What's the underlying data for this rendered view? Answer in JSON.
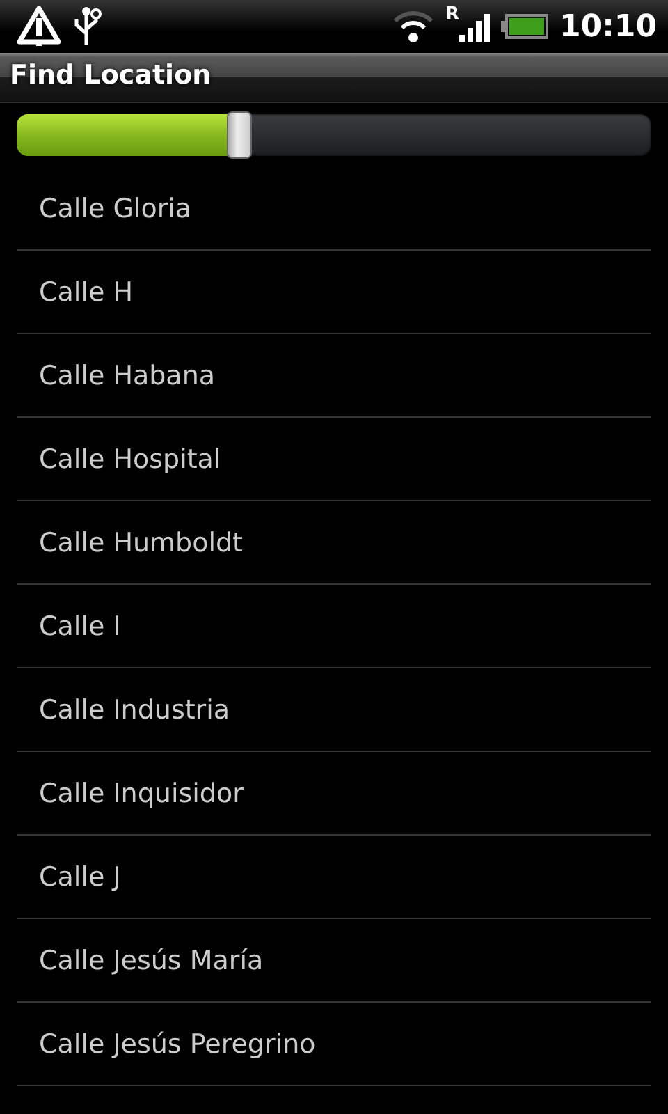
{
  "status_bar": {
    "time": "10:10",
    "network_letter": "R"
  },
  "title_bar": {
    "title": "Find Location"
  },
  "slider": {
    "level": 0.35
  },
  "list": {
    "items": [
      {
        "label": "Calle Gloria"
      },
      {
        "label": "Calle H"
      },
      {
        "label": "Calle Habana"
      },
      {
        "label": "Calle Hospital"
      },
      {
        "label": "Calle Humboldt"
      },
      {
        "label": "Calle I"
      },
      {
        "label": "Calle Industria"
      },
      {
        "label": "Calle Inquisidor"
      },
      {
        "label": "Calle J"
      },
      {
        "label": "Calle Jesús María"
      },
      {
        "label": "Calle Jesús Peregrino"
      }
    ]
  }
}
